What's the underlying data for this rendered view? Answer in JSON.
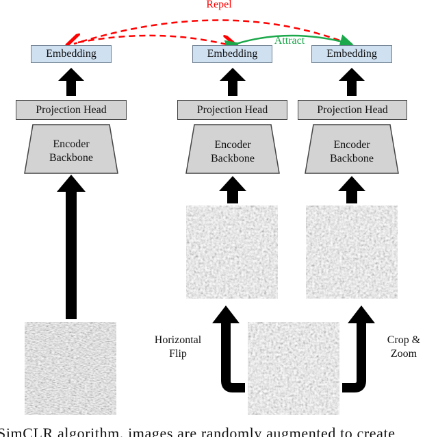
{
  "arrows": {
    "repel": "Repel",
    "attract": "Attract",
    "repel_color": "#ff0000",
    "attract_color": "#1aa84a"
  },
  "embedding": "Embedding",
  "projection_head": "Projection Head",
  "encoder": {
    "line1": "Encoder",
    "line2": "Backbone"
  },
  "augmentations": {
    "left_line1": "Horizontal",
    "left_line2": "Flip",
    "right_line1": "Crop &",
    "right_line2": "Zoom"
  },
  "caption": "SimCLR algorithm, images are randomly augmented to create"
}
